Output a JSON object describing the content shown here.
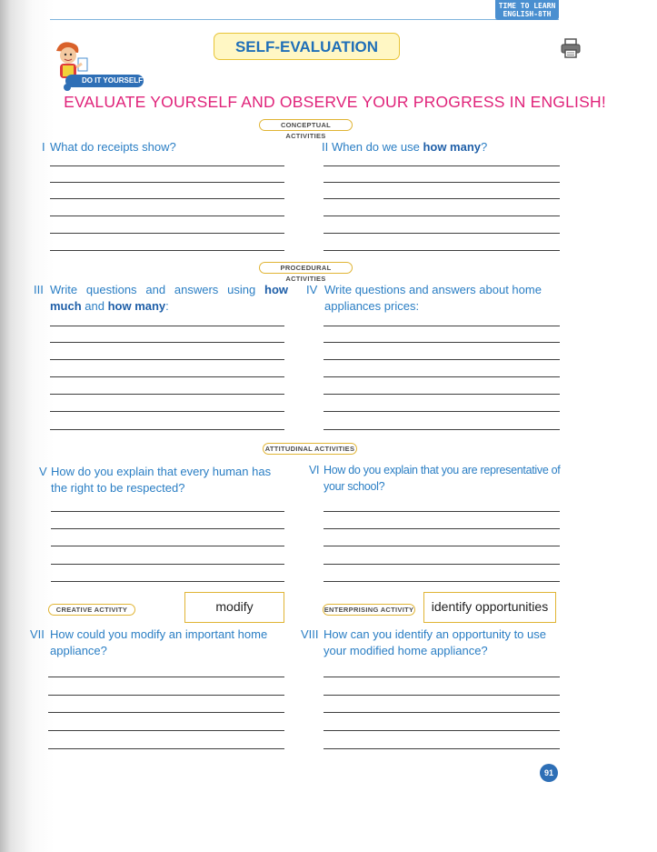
{
  "brand": {
    "line1": "TIME TO LEARN",
    "line2": "ENGLISH-8TH"
  },
  "title": "SELF-EVALUATION",
  "badge": "DO IT YOURSELF",
  "headline": "EVALUATE YOURSELF AND OBSERVE YOUR PROGRESS IN ENGLISH!",
  "sections": {
    "conceptual": "CONCEPTUAL ACTIVITIES",
    "procedural": "PROCEDURAL ACTIVITIES",
    "attitudinal": "ATTITUDINAL ACTIVITIES",
    "creative": "CREATIVE ACTIVITY",
    "enterprising": "ENTERPRISING ACTIVITY"
  },
  "questions": {
    "q1": {
      "num": "I",
      "text": "What do receipts show?"
    },
    "q2": {
      "num": "II",
      "pre": "When do we use ",
      "bold": "how many",
      "post": "?"
    },
    "q3": {
      "num": "III",
      "pre": "Write questions and answers using ",
      "bold1": "how much",
      "mid": " and ",
      "bold2": "how many",
      "post": ":"
    },
    "q4": {
      "num": "IV",
      "text": "Write questions and answers about home appliances prices:"
    },
    "q5": {
      "num": "V",
      "text": "How do you explain that every human has the right to be respected?"
    },
    "q6": {
      "num": "VI",
      "text": "How do you explain that you are representative of your school?"
    },
    "q7": {
      "num": "VII",
      "text": "How could you modify an important home appliance?"
    },
    "q8": {
      "num": "VIII",
      "text": "How can you identify an opportunity to use your modified home appliance?"
    }
  },
  "word_boxes": {
    "creative": "modify",
    "enterprising": "identify opportunities"
  },
  "page_number": "91",
  "icons": {
    "printer": "printer-icon",
    "mascot": "boy-mascot-icon"
  }
}
